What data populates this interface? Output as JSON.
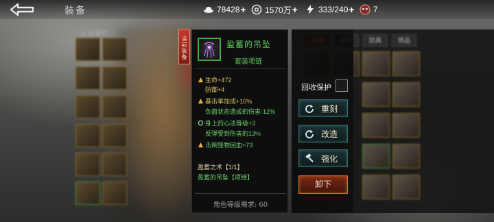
{
  "header": {
    "title": "装备",
    "resources": [
      {
        "icon": "silver-ingot-icon",
        "value": "78428",
        "plus": "+"
      },
      {
        "icon": "coin-icon",
        "value": "1570万",
        "plus": "+"
      },
      {
        "icon": "lightning-stamina-icon",
        "value": "333/240",
        "plus": "+"
      },
      {
        "icon": "demon-mask-icon",
        "value": "7",
        "plus": ""
      }
    ]
  },
  "left_panel": {
    "label": "X 装备栏"
  },
  "item": {
    "equipped_tag": "当前装备",
    "name": "盈蓄的吊坠",
    "type": "套装项链",
    "stats": [
      {
        "text": "生命+472",
        "color": "gold",
        "icon": "star-icon"
      },
      {
        "text": "防御+4",
        "color": "gold",
        "icon": ""
      },
      {
        "text": "暴击率加成+10%",
        "color": "gold",
        "icon": "star-icon"
      },
      {
        "text": "负面状态造成的伤害-12%",
        "color": "green",
        "icon": ""
      },
      {
        "text": "身上的心法等级+3",
        "color": "green",
        "icon": "refresh-icon"
      },
      {
        "text": "反弹受到伤害的13%",
        "color": "green",
        "icon": ""
      },
      {
        "text": "击倒怪物回血+73",
        "color": "green",
        "icon": "star-icon"
      }
    ],
    "set_title": "盈蓄之术【1/1】",
    "set_item": "盈蓄的吊坠【项链】",
    "requirement": "角色等级需求: 60"
  },
  "actions": {
    "protect_label": "回收保护",
    "recast_label": "重刻",
    "reforge_label": "改造",
    "enhance_label": "强化",
    "unequip_label": "卸下"
  },
  "bag": {
    "tabs": [
      "全部",
      "武器",
      "防具",
      "饰品"
    ]
  },
  "colors": {
    "gold": "#d8c25c",
    "green": "#6fcf6f",
    "item_border": "#3fae3f",
    "unequip": "#d4702f",
    "action_teal": "#2f6f70"
  }
}
